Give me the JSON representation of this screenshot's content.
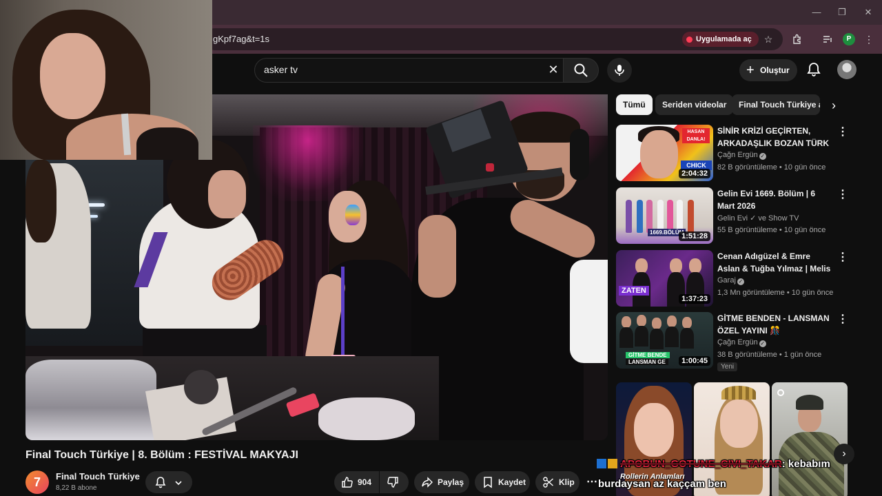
{
  "browser": {
    "url_fragment": "gKpf7ag&t=1s",
    "open_in_app": "Uygulamada aç",
    "profile_initial": "P"
  },
  "header": {
    "search_value": "asker tv",
    "create_label": "Oluştur"
  },
  "chips": [
    {
      "label": "Tümü",
      "active": true
    },
    {
      "label": "Seriden videolar",
      "active": false
    },
    {
      "label": "Final Touch Türkiye a",
      "active": false
    }
  ],
  "recommendations": [
    {
      "title": "SİNİR KRİZİ GEÇİRTEN, ARKADAŞLIK BOZAN TÜRK ...",
      "channel": "Çağn Ergün",
      "meta": "82 B görüntüleme • 10 gün önce",
      "duration": "2:04:32",
      "thumb_text_top": "HASAN DANLA!",
      "thumb_text_bottom": "CHICK"
    },
    {
      "title": "Gelin Evi 1669. Bölüm | 6 Mart 2026",
      "channel": "Gelin Evi ✓ ve Show TV",
      "meta": "55 B görüntüleme • 10 gün önce",
      "duration": "1:51:28",
      "thumb_text": "1669.BÖLÜM"
    },
    {
      "title": "Cenan Adıgüzel & Emre Aslan & Tuğba Yılmaz | Melis İşiten ile ...",
      "channel": "Garaj",
      "meta": "1,3 Mn görüntüleme • 10 gün önce",
      "duration": "1:37:23",
      "thumb_text": "ZATEN"
    },
    {
      "title": "GİTME BENDEN - LANSMAN ÖZEL YAYINI 🎊",
      "channel": "Çağn Ergün",
      "meta": "38 B görüntüleme • 1 gün önce",
      "duration": "1:00:45",
      "badge": "Yeni",
      "thumb_text_top": "GİTME BENDE",
      "thumb_text_bottom": "LANSMAN GE"
    }
  ],
  "shorts_overlay_text": "Rollerin Anlamları",
  "video": {
    "title": "Final Touch Türkiye | 8. Bölüm : FESTİVAL MAKYAJI",
    "channel_name": "Final Touch Türkiye",
    "channel_initial": "7",
    "subscribers": "8,22 B abone",
    "likes": "904",
    "share_label": "Paylaş",
    "save_label": "Kaydet",
    "clip_label": "Klip"
  },
  "chat": {
    "username": "APOBUN_GOTUNE_CIVI_TAKAR",
    "message": "kebabım",
    "line2": "burdaysan az kaççam ben"
  },
  "colors": {
    "background": "#0f0f0f",
    "chrome": "#3a2a33",
    "accent_red": "#ff3d56",
    "chat_username": "#e3223c"
  }
}
